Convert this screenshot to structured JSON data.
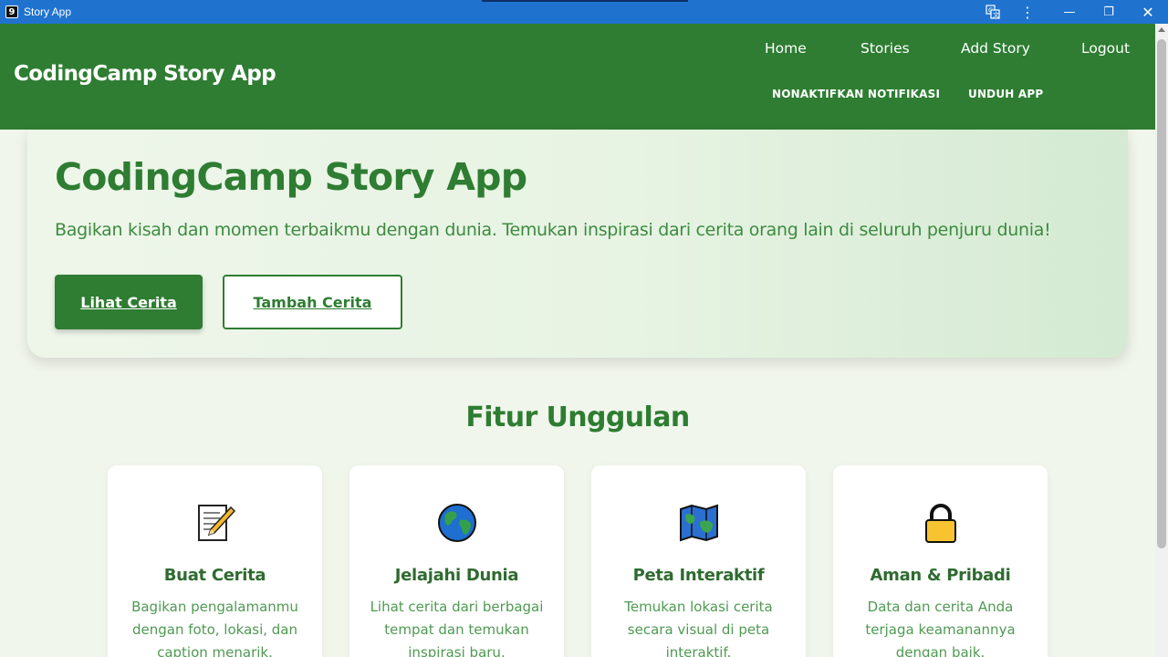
{
  "window": {
    "title": "Story App",
    "app_icon_glyph": "9",
    "controls": {
      "translate_icon": "translate-icon",
      "menu_icon": "kebab-icon",
      "minimize": "—",
      "restore": "❐",
      "close": "✕"
    }
  },
  "header": {
    "brand": "CodingCamp Story App",
    "nav": {
      "home": "Home",
      "stories": "Stories",
      "add_story": "Add Story",
      "logout": "Logout"
    },
    "actions": {
      "notifications": "NONAKTIFKAN NOTIFIKASI",
      "download": "UNDUH APP"
    }
  },
  "hero": {
    "title": "CodingCamp Story App",
    "subtitle": "Bagikan kisah dan momen terbaikmu dengan dunia. Temukan inspirasi dari cerita orang lain di seluruh penjuru dunia!",
    "primary_button": "Lihat Cerita",
    "secondary_button": "Tambah Cerita"
  },
  "features": {
    "title": "Fitur Unggulan",
    "items": [
      {
        "icon": "memo-icon",
        "title": "Buat Cerita",
        "description": "Bagikan pengalamanmu dengan foto, lokasi, dan caption menarik."
      },
      {
        "icon": "globe-icon",
        "title": "Jelajahi Dunia",
        "description": "Lihat cerita dari berbagai tempat dan temukan inspirasi baru."
      },
      {
        "icon": "map-icon",
        "title": "Peta Interaktif",
        "description": "Temukan lokasi cerita secara visual di peta interaktif."
      },
      {
        "icon": "lock-icon",
        "title": "Aman & Pribadi",
        "description": "Data dan cerita Anda terjaga keamanannya dengan baik."
      }
    ]
  },
  "colors": {
    "primary": "#2e7d32",
    "titlebar": "#1f73cf",
    "background": "#f1f6ec"
  }
}
